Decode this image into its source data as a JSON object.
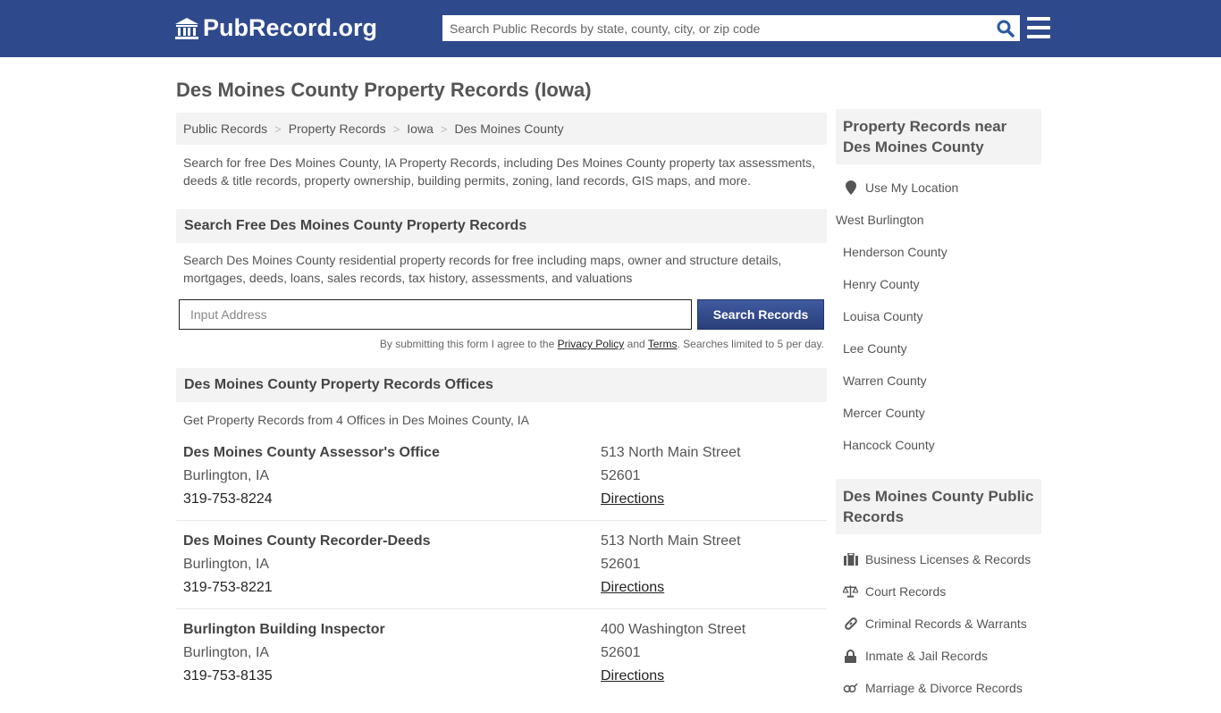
{
  "header": {
    "logo_text": "PubRecord.org",
    "search_placeholder": "Search Public Records by state, county, city, or zip code",
    "colors": {
      "brand": "#2e4a8c"
    }
  },
  "page": {
    "title": "Des Moines County Property Records (Iowa)",
    "breadcrumb": [
      "Public Records",
      "Property Records",
      "Iowa",
      "Des Moines County"
    ],
    "intro": "Search for free Des Moines County, IA Property Records, including Des Moines County property tax assessments, deeds & title records, property ownership, building permits, zoning, land records, GIS maps, and more."
  },
  "search_section": {
    "heading": "Search Free Des Moines County Property Records",
    "description": "Search Des Moines County residential property records for free including maps, owner and structure details, mortgages, deeds, loans, sales records, tax history, assessments, and valuations",
    "input_placeholder": "Input Address",
    "button_label": "Search Records",
    "disclaimer_pre": "By submitting this form I agree to the ",
    "privacy_label": "Privacy Policy",
    "disclaimer_mid": " and ",
    "terms_label": "Terms",
    "disclaimer_post": ". Searches limited to 5 per day."
  },
  "offices_section": {
    "heading": "Des Moines County Property Records Offices",
    "subtitle": "Get Property Records from 4 Offices in Des Moines County, IA",
    "offices": [
      {
        "name": "Des Moines County Assessor's Office",
        "city": "Burlington, IA",
        "phone": "319-753-8224",
        "address": "513 North Main Street",
        "zip": "52601",
        "directions": "Directions"
      },
      {
        "name": "Des Moines County Recorder-Deeds",
        "city": "Burlington, IA",
        "phone": "319-753-8221",
        "address": "513 North Main Street",
        "zip": "52601",
        "directions": "Directions"
      },
      {
        "name": "Burlington Building Inspector",
        "city": "Burlington, IA",
        "phone": "319-753-8135",
        "address": "400 Washington Street",
        "zip": "52601",
        "directions": "Directions"
      }
    ]
  },
  "sidebar": {
    "nearby_heading": "Property Records near Des Moines County",
    "use_location": "Use My Location",
    "nearby": [
      "West Burlington",
      "Henderson County",
      "Henry County",
      "Louisa County",
      "Lee County",
      "Warren County",
      "Mercer County",
      "Hancock County"
    ],
    "public_heading": "Des Moines County Public Records",
    "public_links": [
      {
        "label": "Business Licenses & Records",
        "icon": "briefcase-icon"
      },
      {
        "label": "Court Records",
        "icon": "scales-icon"
      },
      {
        "label": "Criminal Records & Warrants",
        "icon": "link-icon"
      },
      {
        "label": "Inmate & Jail Records",
        "icon": "lock-icon"
      },
      {
        "label": "Marriage & Divorce Records",
        "icon": "venus-mars-icon"
      }
    ]
  }
}
